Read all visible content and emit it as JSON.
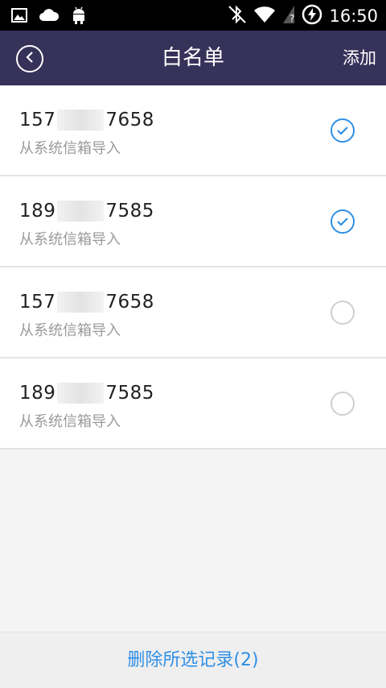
{
  "status_bar": {
    "time": "16:50",
    "left_icons": [
      "image-icon",
      "cloud-icon",
      "android-icon"
    ],
    "right_icons": [
      "bluetooth-off-icon",
      "wifi-icon",
      "no-sim-icon",
      "battery-charging-icon"
    ]
  },
  "header": {
    "title": "白名单",
    "add_label": "添加",
    "back_icon": "chevron-left-icon"
  },
  "list": {
    "items": [
      {
        "prefix": "157",
        "suffix": "7658",
        "source": "从系统信箱导入",
        "checked": true
      },
      {
        "prefix": "189",
        "suffix": "7585",
        "source": "从系统信箱导入",
        "checked": true
      },
      {
        "prefix": "157",
        "suffix": "7658",
        "source": "从系统信箱导入",
        "checked": false
      },
      {
        "prefix": "189",
        "suffix": "7585",
        "source": "从系统信箱导入",
        "checked": false
      }
    ]
  },
  "footer": {
    "delete_label": "删除所选记录(2)"
  },
  "colors": {
    "header_bg": "#37325a",
    "accent": "#2f8fe6",
    "status_bg": "#000000",
    "page_bg": "#f4f4f4"
  }
}
